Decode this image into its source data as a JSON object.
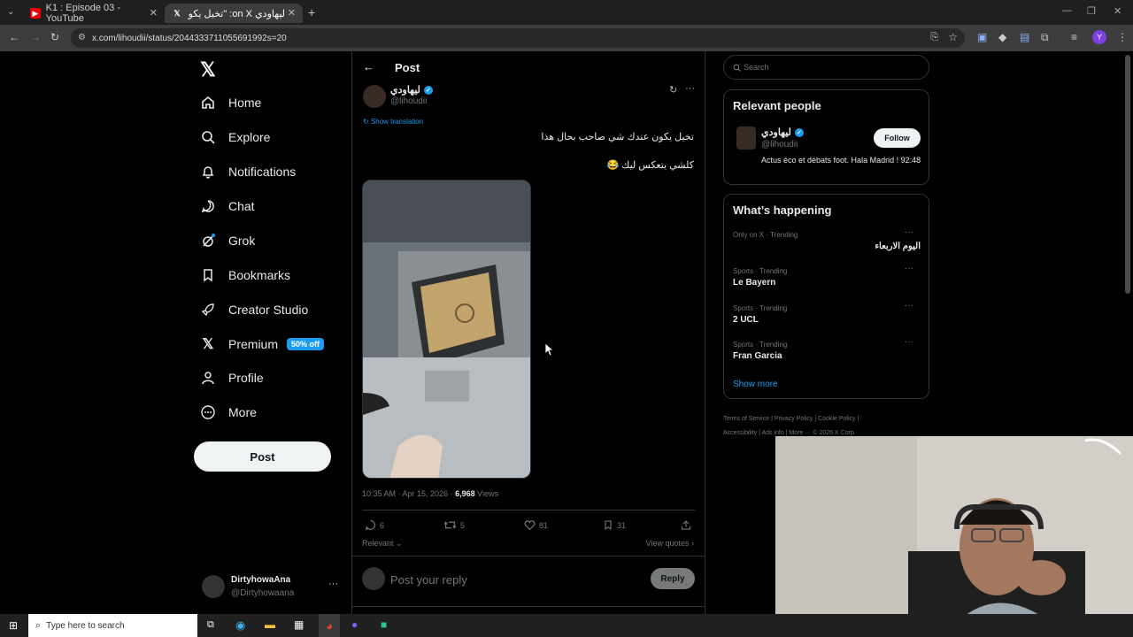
{
  "browser": {
    "tabs": [
      {
        "title": "K1 : Episode 03 - YouTube",
        "icon": "youtube-icon"
      },
      {
        "title": "ليهاودي on X: \"تخيل يكون عند...",
        "icon": "x-icon"
      }
    ],
    "url": "x.com/lihoudii/status/2044333711055691992s=20"
  },
  "nav": {
    "items": [
      {
        "label": "Home",
        "icon": "home-icon"
      },
      {
        "label": "Explore",
        "icon": "search-icon"
      },
      {
        "label": "Notifications",
        "icon": "bell-icon"
      },
      {
        "label": "Chat",
        "icon": "chat-icon"
      },
      {
        "label": "Grok",
        "icon": "grok-icon"
      },
      {
        "label": "Bookmarks",
        "icon": "bookmark-icon"
      },
      {
        "label": "Creator Studio",
        "icon": "rocket-icon"
      },
      {
        "label": "Premium",
        "icon": "x-icon"
      },
      {
        "label": "Profile",
        "icon": "person-icon"
      },
      {
        "label": "More",
        "icon": "more-circle-icon"
      }
    ],
    "premium_badge": "50% off",
    "post_button": "Post",
    "account": {
      "name": "DirtyhowaAna",
      "handle": "@Dirtyhowaana"
    }
  },
  "post": {
    "header": "Post",
    "author": {
      "name": "ليهاودي",
      "handle": "@lihoudii"
    },
    "show_translation": "Show translation",
    "text_line1": "تخيل يكون عندك شي صاحب بحال هذا",
    "text_line2": "كلشي يتعكس ليك 😂",
    "timestamp": "10:35 AM · Apr 15, 2026 · ",
    "views_count": "6,968",
    "views_label": " Views",
    "replies": "6",
    "reposts": "5",
    "likes": "81",
    "bookmarks": "31",
    "sort": "Relevant",
    "view_quotes": "View quotes",
    "reply_placeholder": "Post your reply",
    "reply_button": "Reply"
  },
  "sidebar": {
    "search_placeholder": "Search",
    "relevant_title": "Relevant people",
    "person": {
      "name": "ليهاودي",
      "handle": "@lihoudii",
      "bio": "Actus éco et débats foot. Hala Madrid ! 92:48",
      "follow": "Follow"
    },
    "happening_title": "What’s happening",
    "trends": [
      {
        "context": "Only on X · Trending",
        "topic": "اليوم الاربعاء"
      },
      {
        "context": "Sports · Trending",
        "topic": "Le Bayern"
      },
      {
        "context": "Sports · Trending",
        "topic": "2 UCL"
      },
      {
        "context": "Sports · Trending",
        "topic": "Fran Garcia"
      }
    ],
    "show_more": "Show more",
    "footer": [
      "Terms of Service",
      "Privacy Policy",
      "Cookie Policy",
      "Accessibility",
      "Ads info",
      "More ···",
      "© 2026 X Corp."
    ]
  },
  "taskbar": {
    "search_placeholder": "Type here to search"
  },
  "colors": {
    "accent": "#1d9bf0",
    "background": "#000000",
    "border": "#2f3336"
  }
}
